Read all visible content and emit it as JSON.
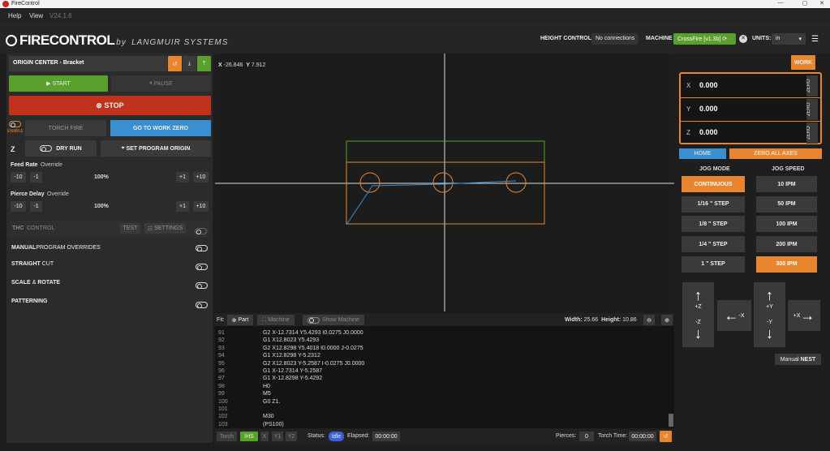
{
  "window": {
    "title": "FireControl",
    "min": "—",
    "max": "▢",
    "close": "✕"
  },
  "menu": {
    "help": "Help",
    "view": "View",
    "version": "V24.1.6"
  },
  "header": {
    "brand": "FIRECONTROL",
    "by": "by",
    "maker": "LANGMUIR SYSTEMS",
    "height_control_label": "HEIGHT CONTROL:",
    "height_control_value": "No connections",
    "machine_label": "MACHINE",
    "machine_value": "CrossFire  [v1.3b]",
    "units_label": "UNITS:",
    "units_value": "in"
  },
  "left": {
    "file_title": "ORIGIN CENTER - Bracket",
    "start": "START",
    "pause": "PAUSE",
    "stop": "STOP",
    "enable": "ENABLE",
    "torch_fire": "TORCH FIRE",
    "go_to_work_zero": "GO TO WORK ZERO",
    "z": "Z",
    "dry_run": "DRY RUN",
    "set_program_origin": "SET PROGRAM ORIGIN",
    "feed_rate": "Feed Rate",
    "feed_override": "Override",
    "feed_pct": "100%",
    "pierce_delay": "Pierce Delay",
    "pierce_override": "Override",
    "pierce_pct": "100%",
    "m10": "-10",
    "m1": "-1",
    "p1": "+1",
    "p10": "+10",
    "thc": "THC",
    "thc_control": "CONTROL",
    "test": "TEST",
    "settings": "SETTINGS",
    "manual": "MANUAL",
    "program_overrides": "PROGRAM OVERRIDES",
    "straight": "STRAIGHT",
    "cut": "CUT",
    "scale": "SCALE",
    "and": "&",
    "rotate": "ROTATE",
    "patterning": "PATTERNING"
  },
  "canvas": {
    "x_label": "X",
    "x_val": "-26.846",
    "y_label": "Y",
    "y_val": "7.912"
  },
  "fitbar": {
    "fit": "Fit:",
    "part": "Part",
    "machine": "Machine",
    "show_machine": "Show Machine",
    "width_label": "Width:",
    "width_val": "25.66",
    "height_label": "Height:",
    "height_val": "10.86"
  },
  "gcode": [
    {
      "n": "91",
      "c": "G2 X-12.7314 Y5.4293 I0.0275 J0.0000"
    },
    {
      "n": "92",
      "c": "G1 X12.8023 Y5.4293"
    },
    {
      "n": "93",
      "c": "G2 X12.8298 Y5.4018 I0.0000 J-0.0275"
    },
    {
      "n": "94",
      "c": "G1 X12.8298 Y-5.2312"
    },
    {
      "n": "95",
      "c": "G2 X12.8023 Y-5.2587 I-0.0275 J0.0000"
    },
    {
      "n": "96",
      "c": "G1 X-12.7314 Y-5.2587"
    },
    {
      "n": "97",
      "c": "G1 X-12.8298 Y-5.4292"
    },
    {
      "n": "98",
      "c": "H0"
    },
    {
      "n": "99",
      "c": "M5"
    },
    {
      "n": "100",
      "c": "G0 Z1."
    },
    {
      "n": "101",
      "c": ""
    },
    {
      "n": "102",
      "c": "M30"
    },
    {
      "n": "103",
      "c": "(PS100)"
    }
  ],
  "status": {
    "torch": "Torch",
    "ihs": "IHS",
    "x": "X",
    "y1": "Y1",
    "y2": "Y2",
    "status_label": "Status:",
    "status_val": "Idle",
    "elapsed_label": "Elapsed:",
    "elapsed_val": "00:00:00",
    "pierces_label": "Pierces:",
    "pierces_val": "0",
    "torch_time_label": "Torch Time:",
    "torch_time_val": "00:00:00"
  },
  "right": {
    "work": "WORK",
    "axes": [
      {
        "name": "X",
        "value": "0.000"
      },
      {
        "name": "Y",
        "value": "0.000"
      },
      {
        "name": "Z",
        "value": "0.000"
      }
    ],
    "zero": "ZERO",
    "home": "HOME",
    "zero_all": "ZERO ALL AXES",
    "jog_mode": "JOG MODE",
    "jog_speed": "JOG SPEED",
    "modes": [
      "CONTINUOUS",
      "1/16 \" STEP",
      "1/8 \" STEP",
      "1/4 \" STEP",
      "1 \" STEP"
    ],
    "speeds": [
      "10 IPM",
      "50 IPM",
      "100 IPM",
      "200 IPM",
      "300 IPM"
    ],
    "pz": "+Z",
    "mz": "-Z",
    "mx": "-X",
    "py": "+Y",
    "my": "-Y",
    "px": "+X",
    "manual": "Manual",
    "nest": "NEST"
  },
  "colors": {
    "accent": "#e8862f",
    "green": "#5aa02c",
    "red": "#c0321c",
    "blue": "#3a8fd0"
  }
}
